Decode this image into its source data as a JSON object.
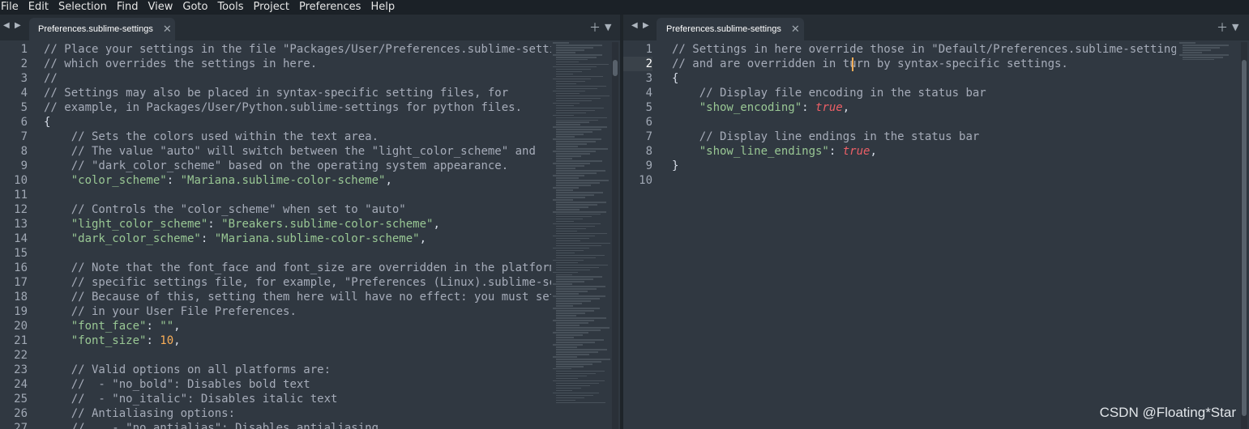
{
  "menu": [
    "File",
    "Edit",
    "Selection",
    "Find",
    "View",
    "Goto",
    "Tools",
    "Project",
    "Preferences",
    "Help"
  ],
  "left": {
    "tab_label": "Preferences.sublime-settings",
    "lines": [
      [
        [
          "c",
          "// Place your settings in the file \"Packages/User/Preferences.sublime-settin"
        ]
      ],
      [
        [
          "c",
          "// which overrides the settings in here."
        ]
      ],
      [
        [
          "c",
          "//"
        ]
      ],
      [
        [
          "c",
          "// Settings may also be placed in syntax-specific setting files, for"
        ]
      ],
      [
        [
          "c",
          "// example, in Packages/User/Python.sublime-settings for python files."
        ]
      ],
      [
        [
          "b",
          "{"
        ]
      ],
      [
        [
          "p",
          "    "
        ],
        [
          "c",
          "// Sets the colors used within the text area."
        ]
      ],
      [
        [
          "p",
          "    "
        ],
        [
          "c",
          "// The value \"auto\" will switch between the \"light_color_scheme\" and"
        ]
      ],
      [
        [
          "p",
          "    "
        ],
        [
          "c",
          "// \"dark_color_scheme\" based on the operating system appearance."
        ]
      ],
      [
        [
          "p",
          "    "
        ],
        [
          "s",
          "\"color_scheme\""
        ],
        [
          "p",
          ": "
        ],
        [
          "s",
          "\"Mariana.sublime-color-scheme\""
        ],
        [
          "p",
          ","
        ]
      ],
      [
        [
          "p",
          ""
        ]
      ],
      [
        [
          "p",
          "    "
        ],
        [
          "c",
          "// Controls the \"color_scheme\" when set to \"auto\""
        ]
      ],
      [
        [
          "p",
          "    "
        ],
        [
          "s",
          "\"light_color_scheme\""
        ],
        [
          "p",
          ": "
        ],
        [
          "s",
          "\"Breakers.sublime-color-scheme\""
        ],
        [
          "p",
          ","
        ]
      ],
      [
        [
          "p",
          "    "
        ],
        [
          "s",
          "\"dark_color_scheme\""
        ],
        [
          "p",
          ": "
        ],
        [
          "s",
          "\"Mariana.sublime-color-scheme\""
        ],
        [
          "p",
          ","
        ]
      ],
      [
        [
          "p",
          ""
        ]
      ],
      [
        [
          "p",
          "    "
        ],
        [
          "c",
          "// Note that the font_face and font_size are overridden in the platform"
        ]
      ],
      [
        [
          "p",
          "    "
        ],
        [
          "c",
          "// specific settings file, for example, \"Preferences (Linux).sublime-set"
        ]
      ],
      [
        [
          "p",
          "    "
        ],
        [
          "c",
          "// Because of this, setting them here will have no effect: you must set"
        ]
      ],
      [
        [
          "p",
          "    "
        ],
        [
          "c",
          "// in your User File Preferences."
        ]
      ],
      [
        [
          "p",
          "    "
        ],
        [
          "s",
          "\"font_face\""
        ],
        [
          "p",
          ": "
        ],
        [
          "s",
          "\"\""
        ],
        [
          "p",
          ","
        ]
      ],
      [
        [
          "p",
          "    "
        ],
        [
          "s",
          "\"font_size\""
        ],
        [
          "p",
          ": "
        ],
        [
          "n",
          "10"
        ],
        [
          "p",
          ","
        ]
      ],
      [
        [
          "p",
          ""
        ]
      ],
      [
        [
          "p",
          "    "
        ],
        [
          "c",
          "// Valid options on all platforms are:"
        ]
      ],
      [
        [
          "p",
          "    "
        ],
        [
          "c",
          "//  - \"no_bold\": Disables bold text"
        ]
      ],
      [
        [
          "p",
          "    "
        ],
        [
          "c",
          "//  - \"no_italic\": Disables italic text"
        ]
      ],
      [
        [
          "p",
          "    "
        ],
        [
          "c",
          "// Antialiasing options:"
        ]
      ],
      [
        [
          "p",
          "    "
        ],
        [
          "c",
          "//    - \"no_antialias\": Disables antialiasing"
        ]
      ]
    ]
  },
  "right": {
    "tab_label": "Preferences.sublime-settings",
    "active_line": 2,
    "lines": [
      [
        [
          "c",
          "// Settings in here override those in \"Default/Preferences.sublime-settings\""
        ]
      ],
      [
        [
          "c",
          "// and are overridden in turn by syntax-specific settings."
        ]
      ],
      [
        [
          "b",
          "{"
        ]
      ],
      [
        [
          "p",
          "    "
        ],
        [
          "c",
          "// Display file encoding in the status bar"
        ]
      ],
      [
        [
          "p",
          "    "
        ],
        [
          "s",
          "\"show_encoding\""
        ],
        [
          "p",
          ": "
        ],
        [
          "k",
          "true"
        ],
        [
          "p",
          ","
        ]
      ],
      [
        [
          "p",
          ""
        ]
      ],
      [
        [
          "p",
          "    "
        ],
        [
          "c",
          "// Display line endings in the status bar"
        ]
      ],
      [
        [
          "p",
          "    "
        ],
        [
          "s",
          "\"show_line_endings\""
        ],
        [
          "p",
          ": "
        ],
        [
          "k",
          "true"
        ],
        [
          "p",
          ","
        ]
      ],
      [
        [
          "b",
          "}"
        ]
      ],
      [
        [
          "p",
          ""
        ]
      ]
    ]
  },
  "watermark": "CSDN @Floating*Star",
  "colors": {
    "background": "#303841",
    "comment": "#a6acb9",
    "string": "#99c794",
    "number": "#f9ae58",
    "keyword": "#ec5f66",
    "cursor": "#f9ae58"
  },
  "icons": [
    "chevron-left-icon",
    "chevron-right-icon",
    "close-icon",
    "plus-icon",
    "dropdown-icon"
  ]
}
